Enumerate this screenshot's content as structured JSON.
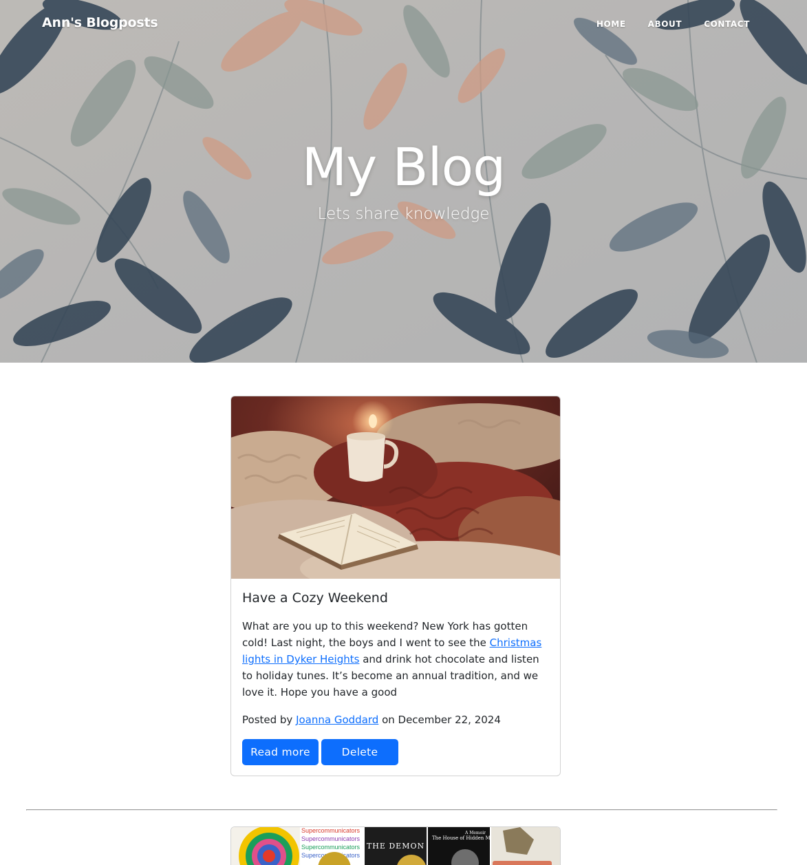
{
  "navbar": {
    "brand": "Ann's Blogposts",
    "links": [
      {
        "label": "HOME"
      },
      {
        "label": "ABOUT"
      },
      {
        "label": "CONTACT"
      }
    ]
  },
  "hero": {
    "heading": "My Blog",
    "subheading": "Lets share knowledge"
  },
  "posts": [
    {
      "title": "Have a Cozy Weekend",
      "body_before_link": "What are you up to this weekend? New York has gotten cold! Last night, the boys and I went to see the ",
      "body_link": "Christmas lights in Dyker Heights",
      "body_after_link": " and drink hot chocolate and listen to holiday tunes. It’s become an annual tradition, and we love it. Hope you have a good",
      "posted_by_prefix": "Posted by ",
      "author": "Joanna Goddard",
      "date_text": " on December 22, 2024",
      "read_more_label": "Read more",
      "delete_label": "Delete"
    }
  ],
  "next_post_cover": {
    "book_spines": [
      "Supercommunicators",
      "Supercommunicators",
      "Supercommunicators",
      "Supercommunicators"
    ],
    "book_title_1": "THE DEMON",
    "book_title_2": "The House of Hidden Meanings",
    "book_tag": "A Memoir"
  },
  "colors": {
    "primary": "#0d6efd",
    "hero_bg": "#c9c6c2",
    "text": "#212529"
  }
}
